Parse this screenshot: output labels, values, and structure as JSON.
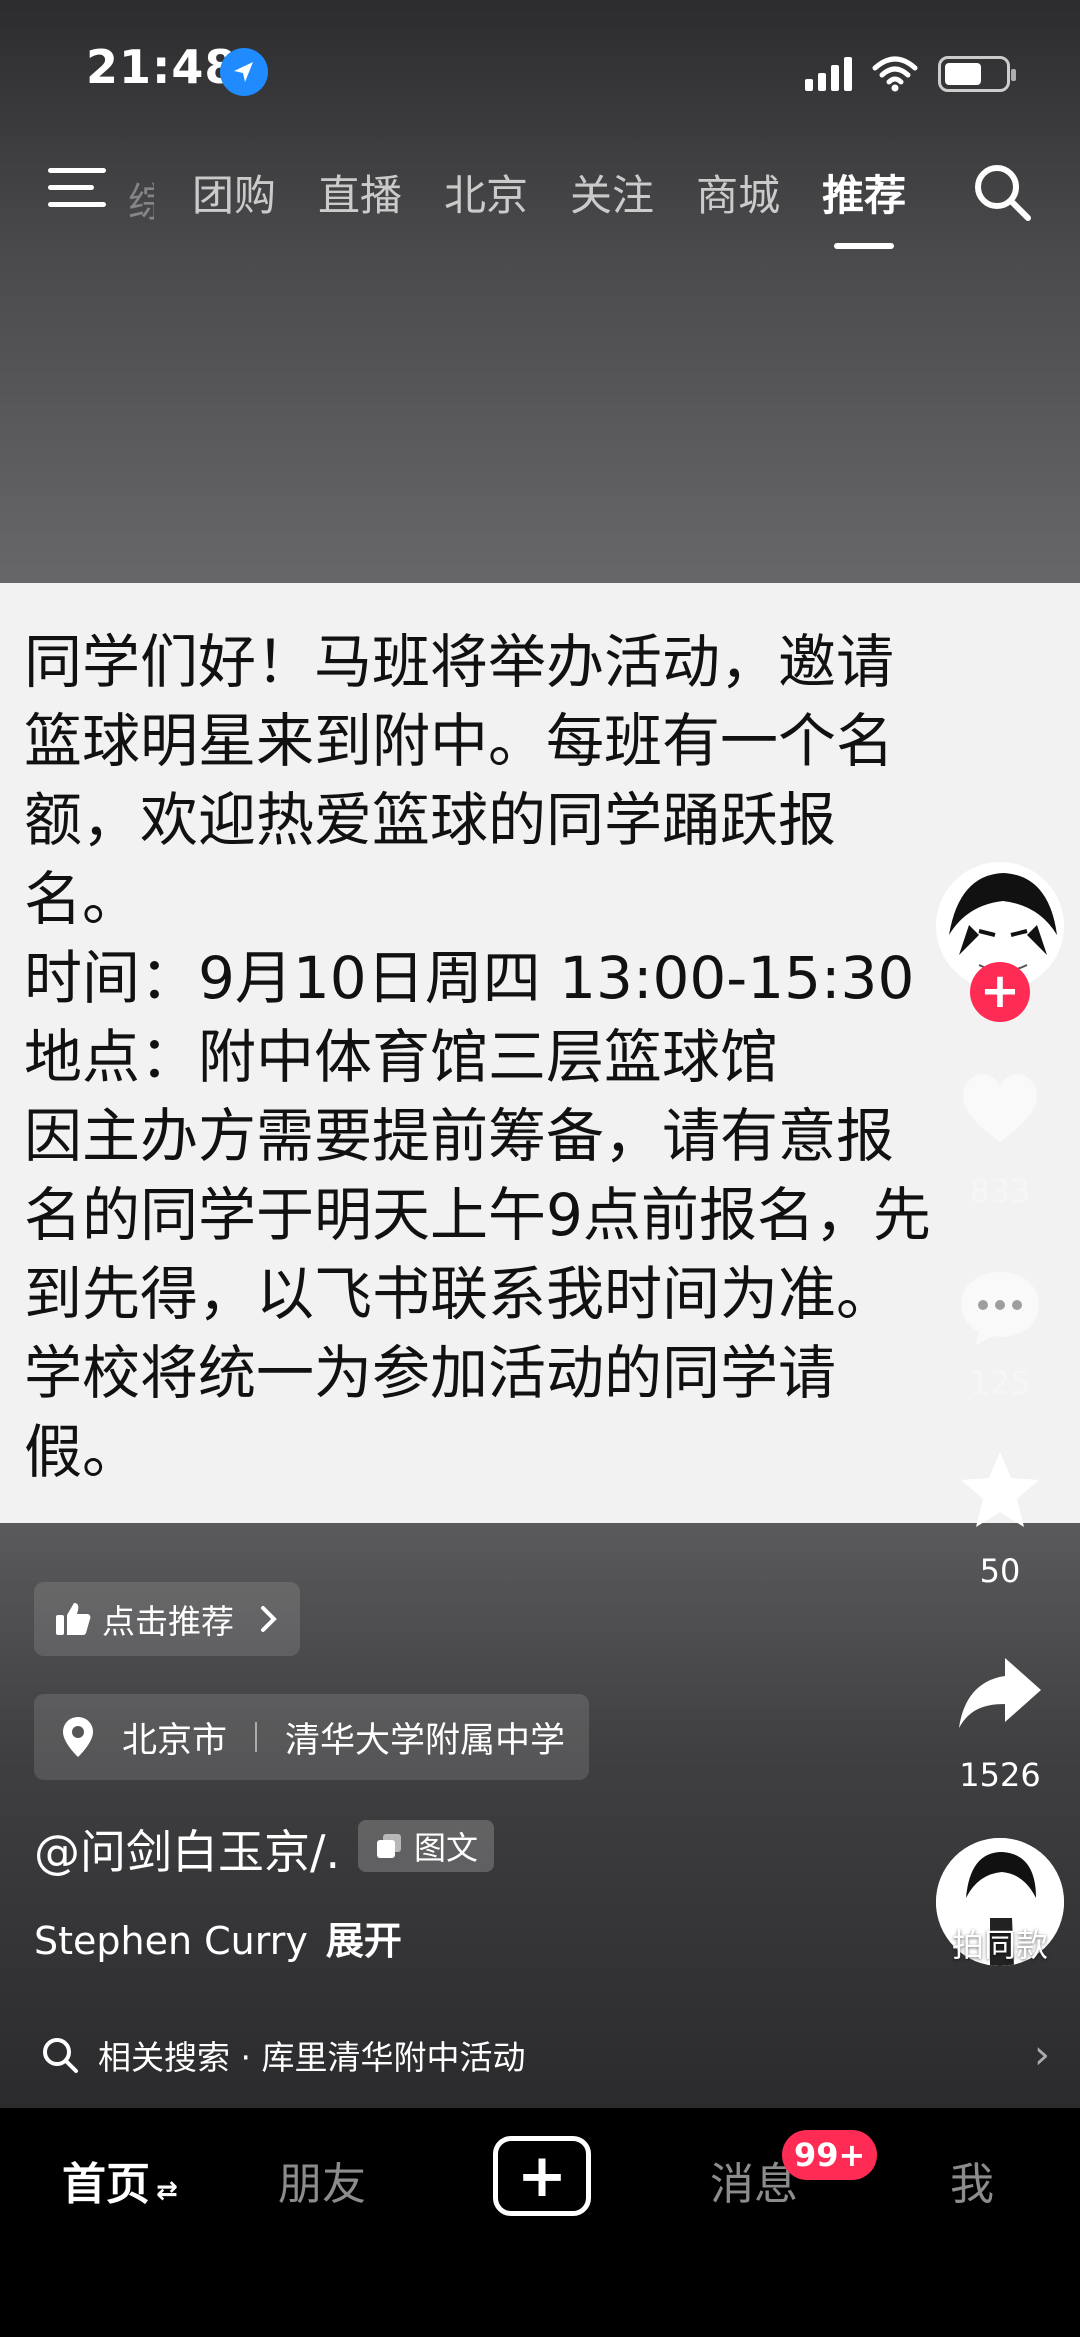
{
  "status_bar": {
    "time": "21:48"
  },
  "top_tabs": {
    "faded_tab": "综",
    "tabs": [
      "团购",
      "直播",
      "北京",
      "关注",
      "商城",
      "推荐"
    ],
    "active_tab": "推荐"
  },
  "post": {
    "lines": [
      "同学们好！马班将举办活动，邀请",
      "篮球明星来到附中。每班有一个名",
      "额，欢迎热爱篮球的同学踊跃报",
      "名。",
      "时间：9月10日周四 13:00-15:30",
      "地点：附中体育馆三层篮球馆",
      "因主办方需要提前筹备，请有意报",
      "名的同学于明天上午9点前报名，先",
      "到先得，以飞书联系我时间为准。",
      "学校将统一为参加活动的同学请",
      "假。"
    ]
  },
  "rail": {
    "follow_label": "+",
    "likes": "833",
    "comments": "125",
    "favorites": "50",
    "shares": "1526",
    "same_style_label": "拍同款"
  },
  "info": {
    "recommend_label": "点击推荐",
    "location_city": "北京市",
    "location_place": "清华大学附属中学",
    "author": "@问剑白玉京/.",
    "type_badge": "图文",
    "description": "Stephen Curry",
    "expand_label": "展开",
    "related_search": "相关搜索 · 库里清华附中活动"
  },
  "bottom_nav": {
    "home": "首页",
    "home_suffix": "⇄",
    "friends": "朋友",
    "messages": "消息",
    "messages_badge": "99+",
    "me": "我"
  },
  "colors": {
    "accent_red": "#fe2c55",
    "location_blue": "#1f8bff",
    "post_bg": "#f2f2f2"
  },
  "icons": [
    "location-arrow-icon",
    "signal-icon",
    "wifi-icon",
    "battery-icon",
    "menu-icon",
    "search-icon",
    "heart-icon",
    "comment-icon",
    "star-icon",
    "share-icon",
    "thumbs-up-icon",
    "chevron-right-icon",
    "map-pin-icon",
    "image-text-icon",
    "plus-icon"
  ]
}
